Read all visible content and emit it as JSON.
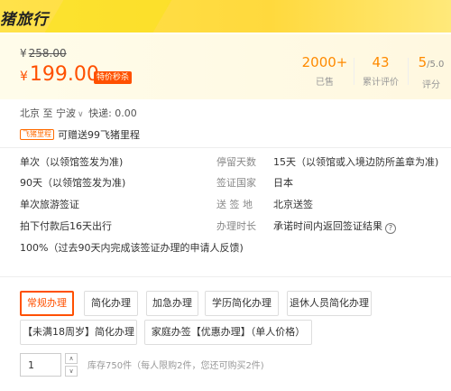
{
  "header": {
    "title": "猪旅行"
  },
  "price": {
    "original_currency": "¥",
    "original": "258.00",
    "current_currency": "¥",
    "current": "199.00",
    "badge": "特价秒杀"
  },
  "stats": [
    {
      "value": "2000+",
      "label": "已售"
    },
    {
      "value": "43",
      "label": "累计评价"
    },
    {
      "value": "5",
      "suffix": "/5.0",
      "label": "评分"
    }
  ],
  "route": {
    "text": "北京 至 宁波",
    "delivery": "快递: 0.00"
  },
  "perk": {
    "tag": "飞猪里程",
    "text": "可赠送99飞猪里程"
  },
  "attributes": {
    "entry_type": "单次（以领馆签发为准)",
    "validity": "90天（以领馆签发为准)",
    "visa_type": "单次旅游签证",
    "schedule": "拍下付款后16天出行",
    "approval": "100%（过去90天内完成该签证办理的申请人反馈)",
    "stay_label": "停留天数",
    "stay_value": "15天（以领馆或入境边防所盖章为准)",
    "country_label": "签证国家",
    "country_value": "日本",
    "dest_label": "送 签 地",
    "dest_value": "北京送签",
    "duration_label": "办理时长",
    "duration_value": "承诺时间内返回签证结果"
  },
  "options": [
    "常规办理",
    "简化办理",
    "加急办理",
    "学历简化办理",
    "退休人员简化办理",
    "【未满18周岁】简化办理",
    "家庭办签【优惠办理】（单人价格）"
  ],
  "quantity": {
    "value": "1",
    "stock": "库存750件（每人限购2件，您还可购买2件)"
  },
  "colors": {
    "accent": "#ff5000",
    "brand_yellow": "#ffdd3c"
  }
}
